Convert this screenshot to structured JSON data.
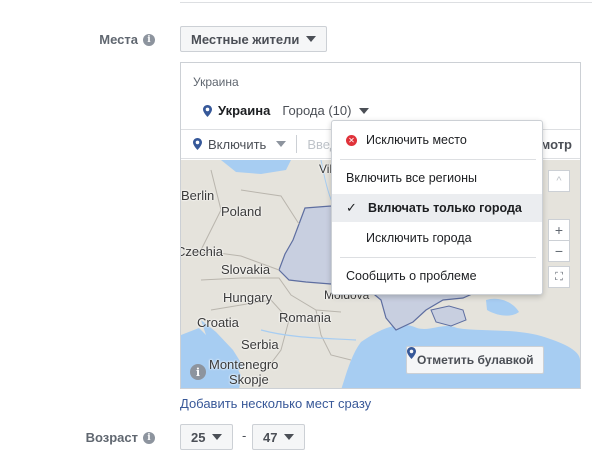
{
  "places": {
    "label": "Места",
    "audience_value": "Местные жители"
  },
  "location_box": {
    "country_header": "Украина",
    "country_name": "Украина",
    "cities_filter": "Города (10)",
    "include_label": "Включить",
    "search_placeholder": "Введ",
    "view_link": "мотр"
  },
  "map": {
    "labels": [
      "Vil",
      "Berlin",
      "Poland",
      "Czechia",
      "Slovakia",
      "Hungary",
      "Croatia",
      "Romania",
      "Serbia",
      "Moldova",
      "Montenegro",
      "Skopje"
    ],
    "drop_pin_label": "Отметить булавкой",
    "zoom_in": "+",
    "zoom_out": "−",
    "fullscreen": "⛶",
    "top_ctrl": "^",
    "colors": {
      "water": "#a7cdf2",
      "land": "#e5e3dc",
      "highlight": "#c8cfe0",
      "border": "#5e6ea0"
    }
  },
  "dropdown": {
    "items": [
      {
        "label": "Исключить место",
        "icon": "exclude-icon",
        "selected": false
      },
      {
        "label": "Включить все регионы",
        "selected": false
      },
      {
        "label": "Включать только города",
        "selected": true
      },
      {
        "label": "Исключить города",
        "selected": false
      },
      {
        "label": "Сообщить о проблеме",
        "selected": false
      }
    ]
  },
  "bulk_add_link": "Добавить несколько мест сразу",
  "age": {
    "label": "Возраст",
    "min": "25",
    "max": "47",
    "dash": "-"
  },
  "colors": {
    "link": "#385898",
    "label_gray": "#606770",
    "pin_blue": "#365899",
    "exclude_red": "#e0323a"
  }
}
